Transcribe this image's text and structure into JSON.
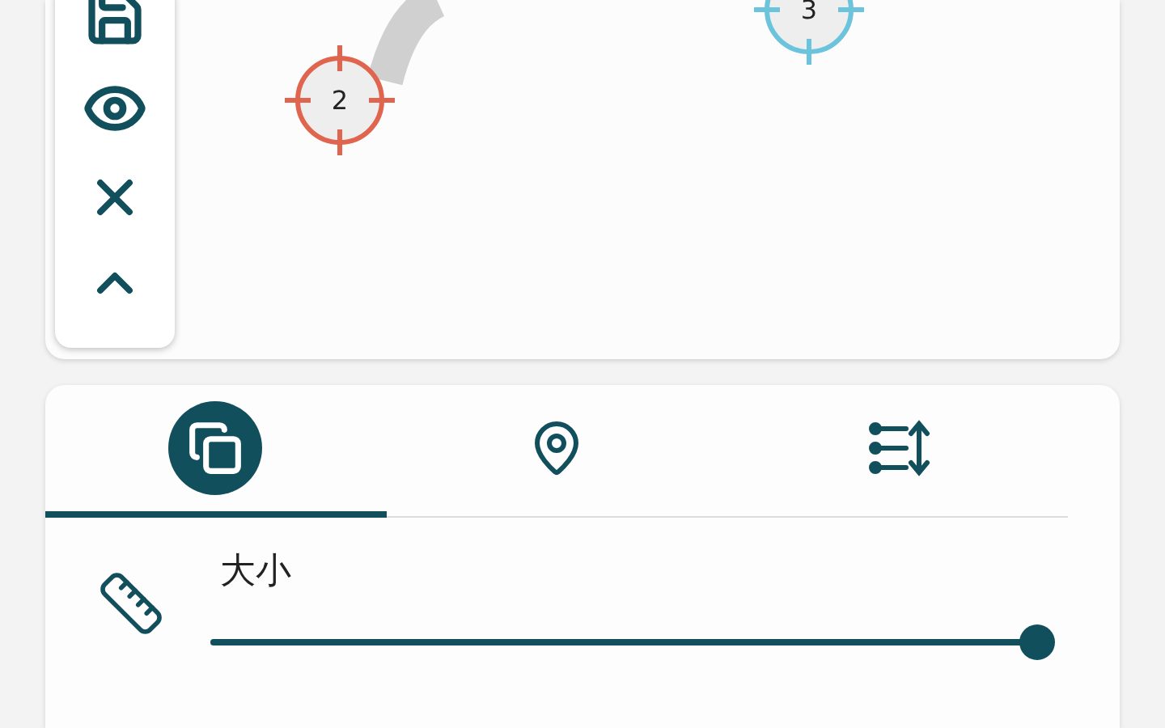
{
  "map": {
    "markers": [
      {
        "label": "2",
        "color": "#e0654f"
      },
      {
        "label": "3",
        "color": "#6cc3dc"
      }
    ]
  },
  "tabs": [
    {
      "selected": true
    },
    {
      "selected": false
    },
    {
      "selected": false
    }
  ],
  "size_setting": {
    "label": "大小",
    "level": 1.0
  }
}
